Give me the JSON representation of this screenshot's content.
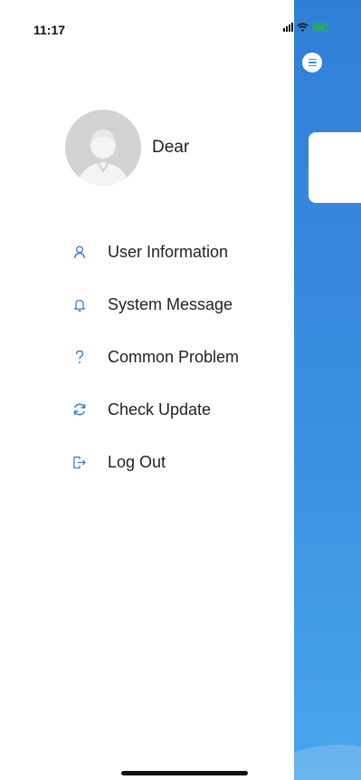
{
  "status_bar": {
    "time": "11:17"
  },
  "profile": {
    "name": "Dear"
  },
  "menu": {
    "items": [
      {
        "label": "User Information",
        "icon": "user-icon"
      },
      {
        "label": "System Message",
        "icon": "bell-icon"
      },
      {
        "label": "Common Problem",
        "icon": "question-icon"
      },
      {
        "label": "Check Update",
        "icon": "refresh-icon"
      },
      {
        "label": "Log Out",
        "icon": "logout-icon"
      }
    ]
  },
  "colors": {
    "accent": "#3b7fd4",
    "background_blue": "#3a8fe0",
    "battery": "#29b34a"
  }
}
